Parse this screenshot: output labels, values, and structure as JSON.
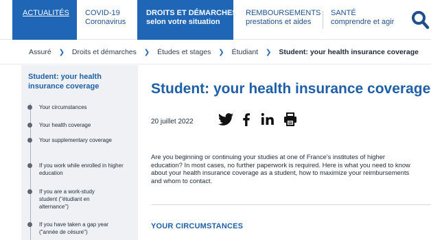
{
  "nav": {
    "items": [
      {
        "line1": "ACTUALITÉS",
        "line2": ""
      },
      {
        "line1": "COVID-19",
        "line2": "Coronavirus"
      },
      {
        "line1": "DROITS ET DÉMARCHES",
        "line2": "selon votre situation"
      },
      {
        "line1": "REMBOURSEMENTS",
        "line2": "prestations et aides"
      },
      {
        "line1": "SANTÉ",
        "line2": "comprendre et agir"
      }
    ],
    "search_icon": "search-icon"
  },
  "breadcrumb": {
    "items": [
      "Assuré",
      "Droits et démarches",
      "Études et stages",
      "Étudiant"
    ],
    "current": "Student: your health insurance coverage"
  },
  "sidebar": {
    "title": "Student: your health insurance coverage",
    "items": [
      "Your circumstances",
      "Your health coverage",
      "Your supplementary coverage",
      "If you work while enrolled in higher education",
      "If you are a work-study student (\"étudiant en alternance\")",
      "If you have taken a gap year (\"année de césure\")"
    ]
  },
  "article": {
    "title": "Student: your health insurance coverage",
    "date": "20 juillet 2022",
    "share_icons": [
      "twitter-icon",
      "facebook-icon",
      "linkedin-icon",
      "print-icon"
    ],
    "intro_lines": [
      "Are you beginning or continuing your studies at one of France's institutes of higher",
      "education? In most cases, no further paperwork is required. Here is what you need to know",
      "about your health insurance coverage as a student, how to maximize your reimbursements",
      "and whom to contact."
    ],
    "section_title": "YOUR CIRCUMSTANCES"
  },
  "colors": {
    "brand_blue": "#1f66b7",
    "title_blue": "#1f5fa8",
    "sidebar_bg": "#eff1f4",
    "text": "#1b2a3b"
  }
}
